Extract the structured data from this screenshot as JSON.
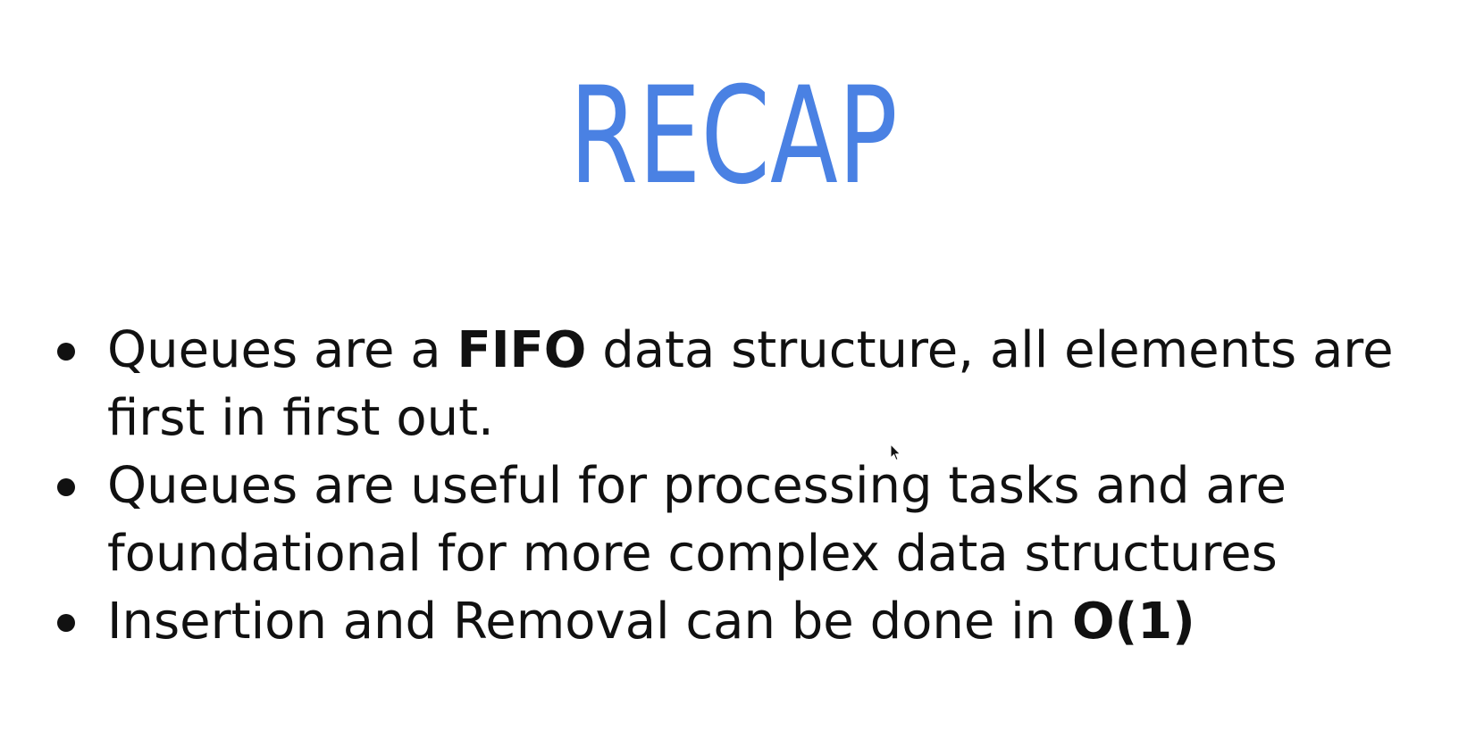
{
  "slide": {
    "title": "RECAP",
    "accent_color": "#4a81e3",
    "bullets": [
      {
        "before": "Queues are a ",
        "bold": "FIFO",
        "after": " data structure, all elements are first in first out."
      },
      {
        "before": "Queues are useful for processing tasks and are foundational for more complex data structures",
        "bold": "",
        "after": ""
      },
      {
        "before": "Insertion and Removal can be done in ",
        "bold": "O(1)",
        "after": ""
      }
    ]
  },
  "icons": {
    "cursor": "mouse-pointer-icon"
  }
}
